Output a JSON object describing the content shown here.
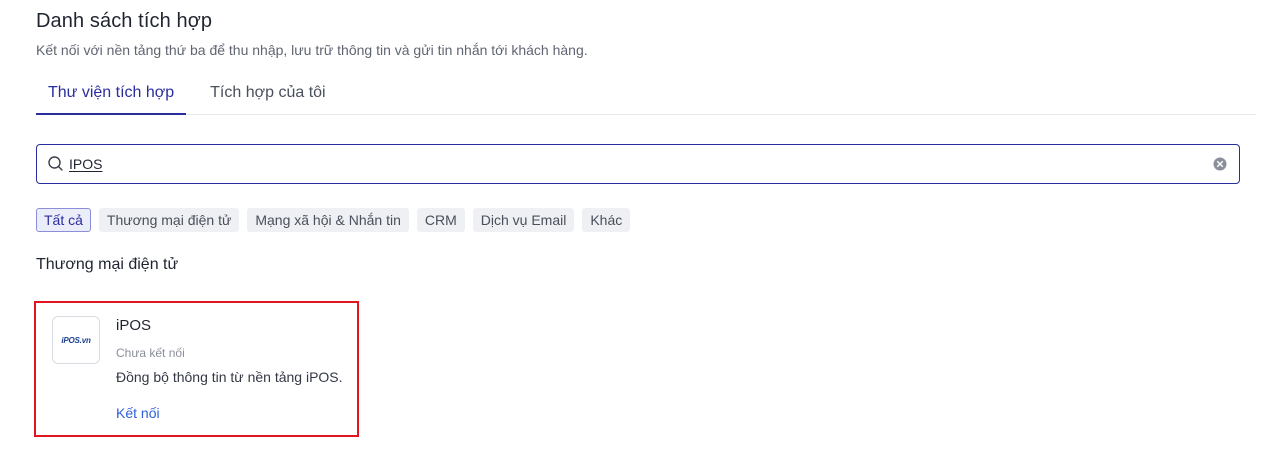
{
  "header": {
    "title": "Danh sách tích hợp",
    "subtitle": "Kết nối với nền tảng thứ ba để thu nhập, lưu trữ thông tin và gửi tin nhắn tới khách hàng."
  },
  "tabs": [
    {
      "label": "Thư viện tích hợp",
      "active": true
    },
    {
      "label": "Tích hợp của tôi",
      "active": false
    }
  ],
  "search": {
    "value": "IPOS",
    "placeholder": "",
    "icon": "search-icon",
    "clear_icon": "clear-circle-icon"
  },
  "filters": [
    {
      "label": "Tất cả",
      "active": true
    },
    {
      "label": "Thương mại điện tử",
      "active": false
    },
    {
      "label": "Mạng xã hội & Nhắn tin",
      "active": false
    },
    {
      "label": "CRM",
      "active": false
    },
    {
      "label": "Dịch vụ Email",
      "active": false
    },
    {
      "label": "Khác",
      "active": false
    }
  ],
  "section": {
    "title": "Thương mại điện tử"
  },
  "integration": {
    "logo_text": "iPOS.vn",
    "name": "iPOS",
    "status": "Chưa kết nối",
    "description": "Đồng bộ thông tin từ nền tảng iPOS.",
    "action": "Kết nối"
  },
  "colors": {
    "accent": "#2a2d9e",
    "link": "#2f5fd8",
    "highlight_border": "#e0151e"
  }
}
